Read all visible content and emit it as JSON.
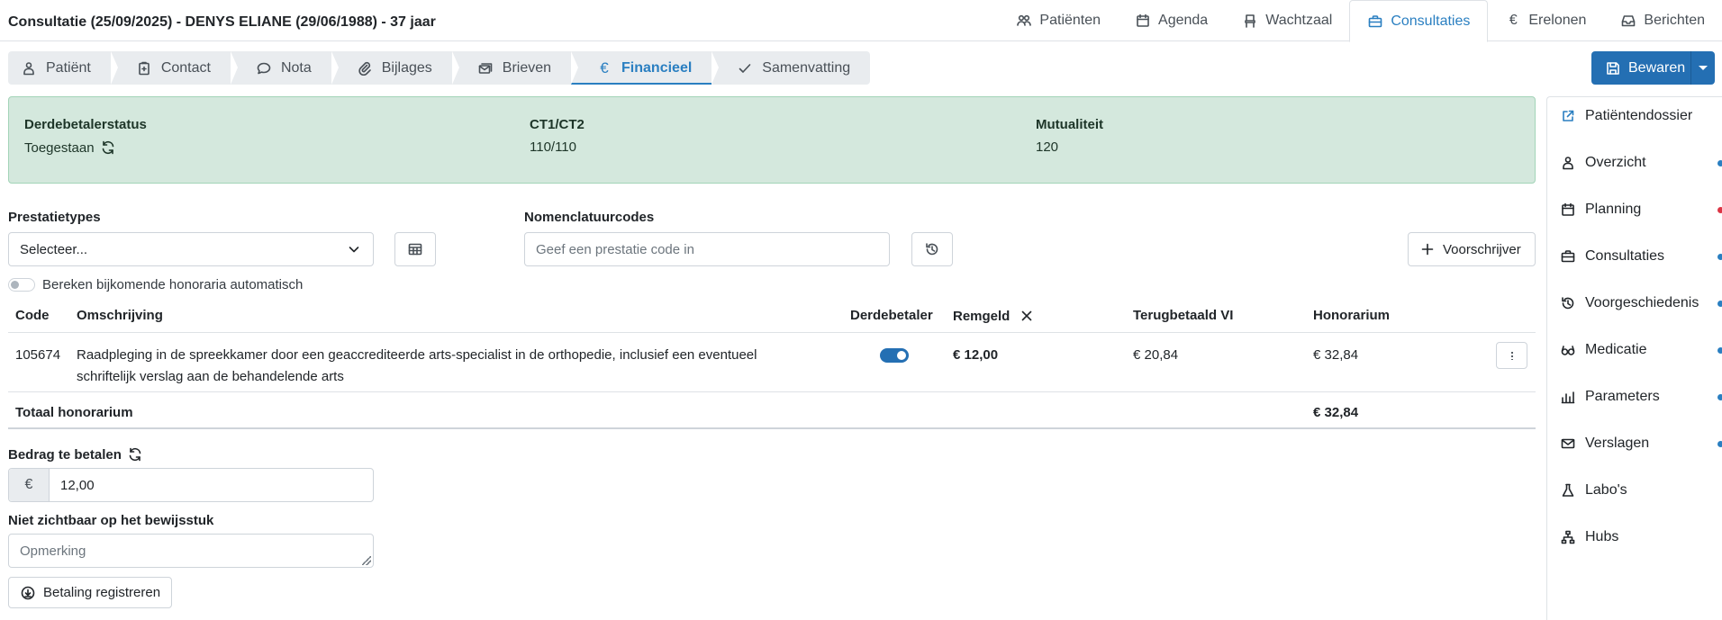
{
  "header": {
    "title": "Consultatie (25/09/2025) - DENYS ELIANE (29/06/1988) - 37 jaar",
    "nav": [
      {
        "label": "Patiënten",
        "icon": "users-icon"
      },
      {
        "label": "Agenda",
        "icon": "calendar-icon"
      },
      {
        "label": "Wachtzaal",
        "icon": "chair-icon"
      },
      {
        "label": "Consultaties",
        "icon": "briefcase-icon",
        "active": true
      },
      {
        "label": "Erelonen",
        "icon": "euro-icon"
      },
      {
        "label": "Berichten",
        "icon": "inbox-icon"
      }
    ]
  },
  "wizard": {
    "tabs": [
      {
        "label": "Patiënt",
        "icon": "person-icon"
      },
      {
        "label": "Contact",
        "icon": "clipboard-icon"
      },
      {
        "label": "Nota",
        "icon": "chat-icon"
      },
      {
        "label": "Bijlages",
        "icon": "paperclip-icon"
      },
      {
        "label": "Brieven",
        "icon": "envelopes-icon"
      },
      {
        "label": "Financieel",
        "icon": "euro-icon",
        "active": true
      },
      {
        "label": "Samenvatting",
        "icon": "check-icon"
      }
    ]
  },
  "save": {
    "label": "Bewaren"
  },
  "status": {
    "derdebetaler_label": "Derdebetalerstatus",
    "derdebetaler_value": "Toegestaan",
    "ct_label": "CT1/CT2",
    "ct_value": "110/110",
    "mut_label": "Mutualiteit",
    "mut_value": "120"
  },
  "form": {
    "prestatietypes_label": "Prestatietypes",
    "prestatietypes_value": "Selecteer...",
    "nomenclatuur_label": "Nomenclatuurcodes",
    "nomenclatuur_placeholder": "Geef een prestatie code in",
    "voorschrijver_label": "Voorschrijver",
    "auto_toggle_label": "Bereken bijkomende honoraria automatisch"
  },
  "table": {
    "headers": {
      "code": "Code",
      "omschrijving": "Omschrijving",
      "derdebetaler": "Derdebetaler",
      "remgeld": "Remgeld",
      "terugbetaald": "Terugbetaald VI",
      "honorarium": "Honorarium"
    },
    "rows": [
      {
        "code": "105674",
        "omschrijving_line1": "Raadpleging in de spreekkamer door een geaccrediteerde arts-specialist in de orthopedie, inclusief een eventueel",
        "omschrijving_line2": "schriftelijk verslag aan de behandelende arts",
        "derdebetaler": true,
        "remgeld": "€ 12,00",
        "terugbetaald": "€ 20,84",
        "honorarium": "€ 32,84"
      }
    ],
    "total_label": "Totaal honorarium",
    "total_value": "€ 32,84"
  },
  "payment": {
    "bedrag_label": "Bedrag te betalen",
    "currency": "€",
    "bedrag_value": "12,00",
    "niet_zichtbaar_label": "Niet zichtbaar op het bewijsstuk",
    "opmerking_placeholder": "Opmerking",
    "register_label": "Betaling registreren"
  },
  "sidebar": {
    "items": [
      {
        "label": "Patiëntendossier",
        "icon": "external-link-icon",
        "dot": ""
      },
      {
        "label": "Overzicht",
        "icon": "person-icon",
        "dot": "#2a7fc1"
      },
      {
        "label": "Planning",
        "icon": "calendar-icon",
        "dot": "#dc3545"
      },
      {
        "label": "Consultaties",
        "icon": "briefcase-icon",
        "dot": "#2a7fc1"
      },
      {
        "label": "Voorgeschiedenis",
        "icon": "history-icon",
        "dot": "#2a7fc1"
      },
      {
        "label": "Medicatie",
        "icon": "glasses-icon",
        "dot": "#2a7fc1"
      },
      {
        "label": "Parameters",
        "icon": "bar-chart-icon",
        "dot": "#2a7fc1"
      },
      {
        "label": "Verslagen",
        "icon": "mail-icon",
        "dot": "#2a7fc1"
      },
      {
        "label": "Labo's",
        "icon": "flask-icon",
        "dot": ""
      },
      {
        "label": "Hubs",
        "icon": "hierarchy-icon",
        "dot": ""
      }
    ]
  },
  "colors": {
    "accent": "#2a7fc1",
    "primary_button": "#246fb3",
    "status_bg": "#d4e8dd",
    "alert_dot": "#dc3545"
  }
}
